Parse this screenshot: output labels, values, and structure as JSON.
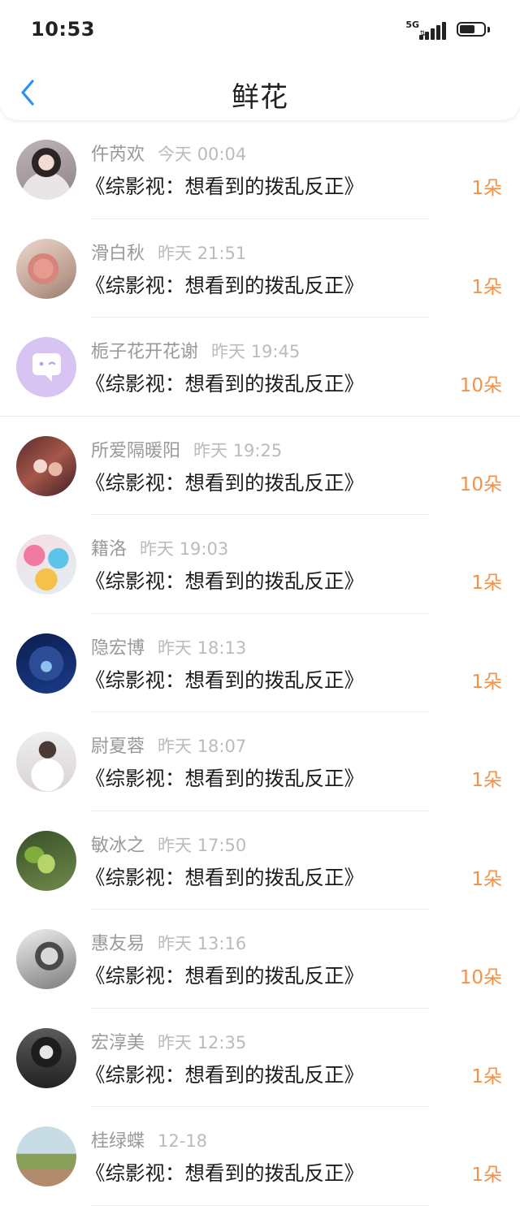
{
  "status_bar": {
    "time": "10:53",
    "network": "5G",
    "battery_level": 0.65
  },
  "header": {
    "title": "鲜花"
  },
  "items": [
    {
      "name": "仵芮欢",
      "time": "今天 00:04",
      "book": "《综影视：想看到的拨乱反正》",
      "count": "1朵",
      "avatar": "girl-photo"
    },
    {
      "name": "滑白秋",
      "time": "昨天 21:51",
      "book": "《综影视：想看到的拨乱反正》",
      "count": "1朵",
      "avatar": "flower-photo"
    },
    {
      "name": "栀子花开花谢",
      "time": "昨天 19:45",
      "book": "《综影视：想看到的拨乱反正》",
      "count": "10朵",
      "avatar": "default-purple-avatar"
    },
    {
      "name": "所爱隔暖阳",
      "time": "昨天 19:25",
      "book": "《综影视：想看到的拨乱反正》",
      "count": "10朵",
      "avatar": "anime-group"
    },
    {
      "name": "籍洛",
      "time": "昨天 19:03",
      "book": "《综影视：想看到的拨乱反正》",
      "count": "1朵",
      "avatar": "balloons"
    },
    {
      "name": "隐宏博",
      "time": "昨天 18:13",
      "book": "《综影视：想看到的拨乱反正》",
      "count": "1朵",
      "avatar": "blue-night"
    },
    {
      "name": "尉夏蓉",
      "time": "昨天 18:07",
      "book": "《综影视：想看到的拨乱反正》",
      "count": "1朵",
      "avatar": "girl-white"
    },
    {
      "name": "敏冰之",
      "time": "昨天 17:50",
      "book": "《综影视：想看到的拨乱反正》",
      "count": "1朵",
      "avatar": "green-orchid"
    },
    {
      "name": "惠友易",
      "time": "昨天 13:16",
      "book": "《综影视：想看到的拨乱反正》",
      "count": "10朵",
      "avatar": "bw-portrait"
    },
    {
      "name": "宏淳美",
      "time": "昨天 12:35",
      "book": "《综影视：想看到的拨乱反正》",
      "count": "1朵",
      "avatar": "dark-cap"
    },
    {
      "name": "桂绿蝶",
      "time": "12-18",
      "book": "《综影视：想看到的拨乱反正》",
      "count": "1朵",
      "avatar": "street-scene"
    }
  ]
}
